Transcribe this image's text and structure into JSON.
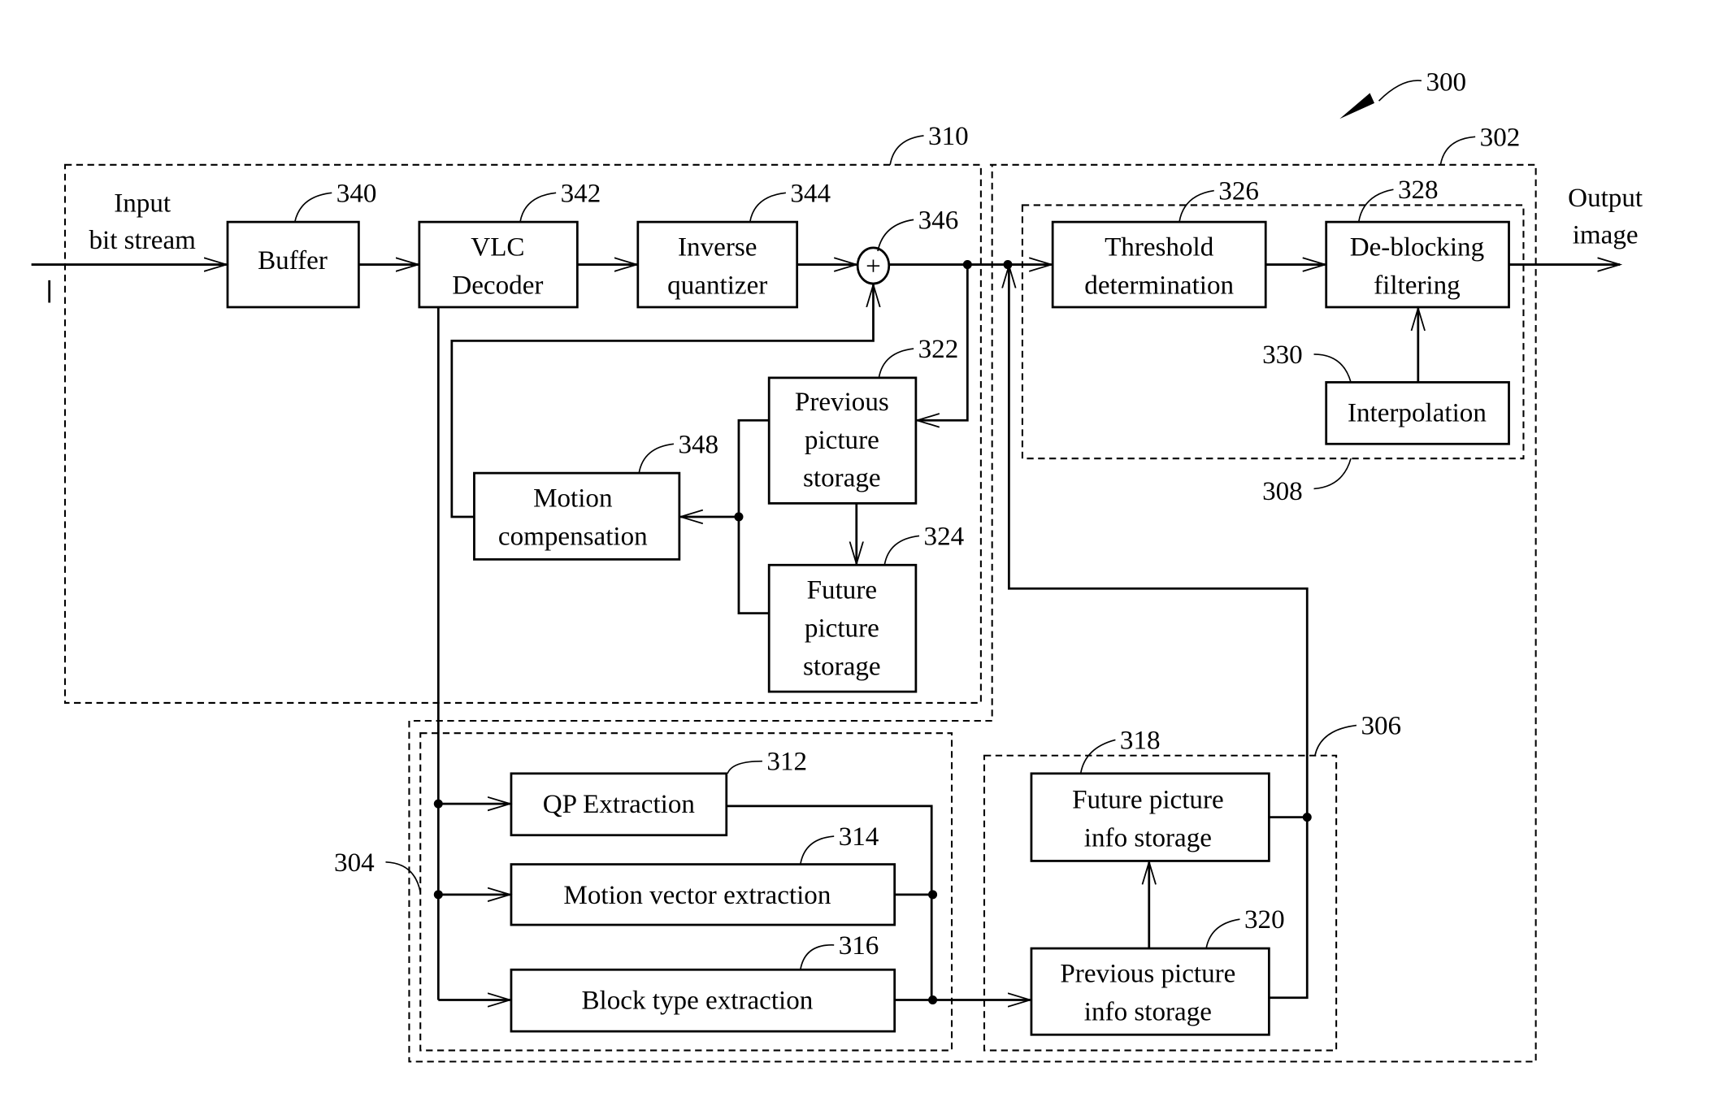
{
  "figure": {
    "number": "300",
    "io": {
      "input_line1": "Input",
      "input_line2": "bit stream",
      "input_mark": "I",
      "output_line1": "Output",
      "output_line2": "image"
    },
    "groups": {
      "decoder": "310",
      "postprocessor": "302",
      "extractor": "304",
      "info_storage": "306",
      "deblocking_unit": "308"
    },
    "blocks": {
      "buffer": {
        "ref": "340",
        "lines": [
          "Buffer"
        ]
      },
      "vlc": {
        "ref": "342",
        "lines": [
          "VLC",
          "Decoder"
        ]
      },
      "invq": {
        "ref": "344",
        "lines": [
          "Inverse",
          "quantizer"
        ]
      },
      "adder": {
        "ref": "346",
        "symbol": "+"
      },
      "prev_pic": {
        "ref": "322",
        "lines": [
          "Previous",
          "picture",
          "storage"
        ]
      },
      "future_pic": {
        "ref": "324",
        "lines": [
          "Future",
          "picture",
          "storage"
        ]
      },
      "motion_comp": {
        "ref": "348",
        "lines": [
          "Motion",
          "compensation"
        ]
      },
      "threshold": {
        "ref": "326",
        "lines": [
          "Threshold",
          "determination"
        ]
      },
      "deblock": {
        "ref": "328",
        "lines": [
          "De-blocking",
          "filtering"
        ]
      },
      "interp": {
        "ref": "330",
        "lines": [
          "Interpolation"
        ]
      },
      "qp": {
        "ref": "312",
        "lines": [
          "QP Extraction"
        ]
      },
      "mv": {
        "ref": "314",
        "lines": [
          "Motion vector extraction"
        ]
      },
      "blocktype": {
        "ref": "316",
        "lines": [
          "Block type extraction"
        ]
      },
      "future_info": {
        "ref": "318",
        "lines": [
          "Future picture",
          "info storage"
        ]
      },
      "prev_info": {
        "ref": "320",
        "lines": [
          "Previous picture",
          "info storage"
        ]
      }
    }
  }
}
